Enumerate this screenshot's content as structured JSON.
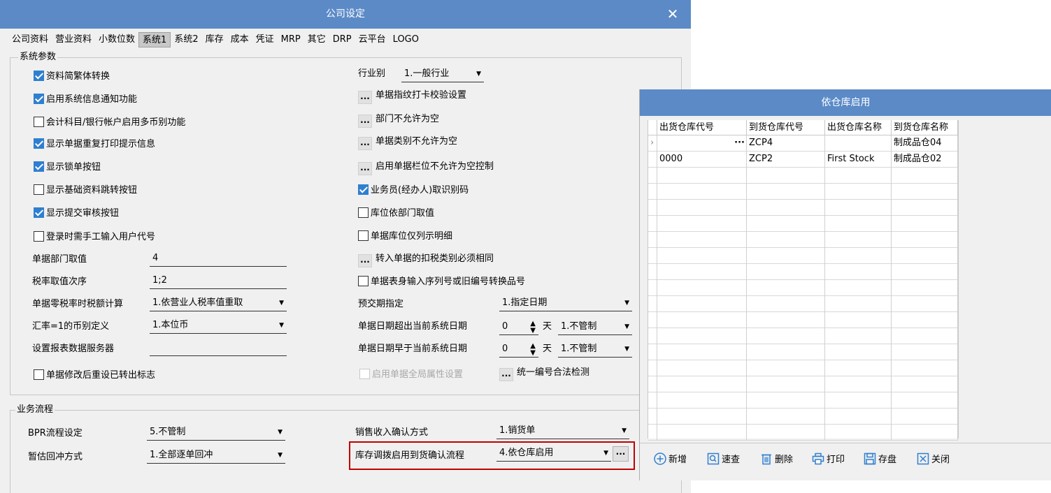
{
  "main": {
    "title": "公司设定",
    "close_icon": "close-icon",
    "tabs": [
      "公司资料",
      "营业资料",
      "小数位数",
      "系统1",
      "系统2",
      "库存",
      "成本",
      "凭证",
      "MRP",
      "其它",
      "DRP",
      "云平台",
      "LOGO"
    ],
    "active_tab": "系统1",
    "system_params": {
      "group_title": "系统参数",
      "checkboxes": [
        {
          "label": "资料简繁体转换",
          "checked": true
        },
        {
          "label": "启用系统信息通知功能",
          "checked": true
        },
        {
          "label": "会计科目/银行帐户启用多币别功能",
          "checked": false
        },
        {
          "label": "显示单据重复打印提示信息",
          "checked": true
        },
        {
          "label": "显示锁单按钮",
          "checked": true
        },
        {
          "label": "显示基础资料跳转按钮",
          "checked": false
        },
        {
          "label": "显示提交审核按钮",
          "checked": true
        },
        {
          "label": "登录时需手工输入用户代号",
          "checked": false
        }
      ],
      "fields": [
        {
          "label": "单据部门取值",
          "value": "4"
        },
        {
          "label": "税率取值次序",
          "value": "1;2"
        },
        {
          "label": "单据零税率时税额计算",
          "value": "1.依营业人税率值重取"
        },
        {
          "label": "汇率=1的币别定义",
          "value": "1.本位币"
        },
        {
          "label": "设置报表数据服务器",
          "value": ""
        }
      ],
      "reset_flag": {
        "label": "单据修改后重设已转出标志",
        "checked": false
      },
      "industry_label": "行业别",
      "industry_value": "1.一般行业",
      "right_buttons": [
        "单据指纹打卡校验设置",
        "部门不允许为空",
        "单据类别不允许为空",
        "启用单据栏位不允许为空控制"
      ],
      "right_checkboxes": [
        {
          "label": "业务员(经办人)取识别码",
          "checked": true
        },
        {
          "label": "库位依部门取值",
          "checked": false
        },
        {
          "label": "单据库位仅列示明细",
          "checked": false
        }
      ],
      "tax_button": "转入单据的扣税类别必须相同",
      "serial_checkbox": {
        "label": "单据表身输入序列号或旧编号转换品号",
        "checked": false
      },
      "prepay_label": "预交期指定",
      "prepay_value": "1.指定日期",
      "date_over": {
        "label": "单据日期超出当前系统日期",
        "num": "0",
        "unit": "天",
        "value": "1.不管制"
      },
      "date_before": {
        "label": "单据日期早于当前系统日期",
        "num": "0",
        "unit": "天",
        "value": "1.不管制"
      },
      "global_attr": {
        "label": "启用单据全局属性设置",
        "checked": false
      },
      "numbering_button": "统一编号合法检测"
    },
    "business_flow": {
      "group_title": "业务流程",
      "bpr_label": "BPR流程设定",
      "bpr_value": "5.不管制",
      "temp_label": "暂估回冲方式",
      "temp_value": "1.全部逐单回冲",
      "sales_label": "销售收入确认方式",
      "sales_value": "1.销货单",
      "transfer_label": "库存调拨启用到货确认流程",
      "transfer_value": "4.依仓库启用",
      "dots": "..."
    }
  },
  "win2": {
    "title": "依仓库启用",
    "columns": [
      "出货仓库代号",
      "到货仓库代号",
      "出货仓库名称",
      "到货仓库名称"
    ],
    "rows": [
      [
        "",
        "ZCP4",
        "",
        "制成品仓04"
      ],
      [
        "0000",
        "ZCP2",
        "First Stock",
        "制成品仓02"
      ]
    ],
    "buttons": [
      {
        "label": "新增",
        "icon": "plus-circle-icon"
      },
      {
        "label": "速查",
        "icon": "search-icon"
      },
      {
        "label": "删除",
        "icon": "trash-icon"
      },
      {
        "label": "打印",
        "icon": "printer-icon"
      },
      {
        "label": "存盘",
        "icon": "save-icon"
      },
      {
        "label": "关闭",
        "icon": "close-box-icon"
      }
    ],
    "colors": {
      "title_bar": "#5b8ac7",
      "icon_blue": "#2f7fd0"
    }
  }
}
